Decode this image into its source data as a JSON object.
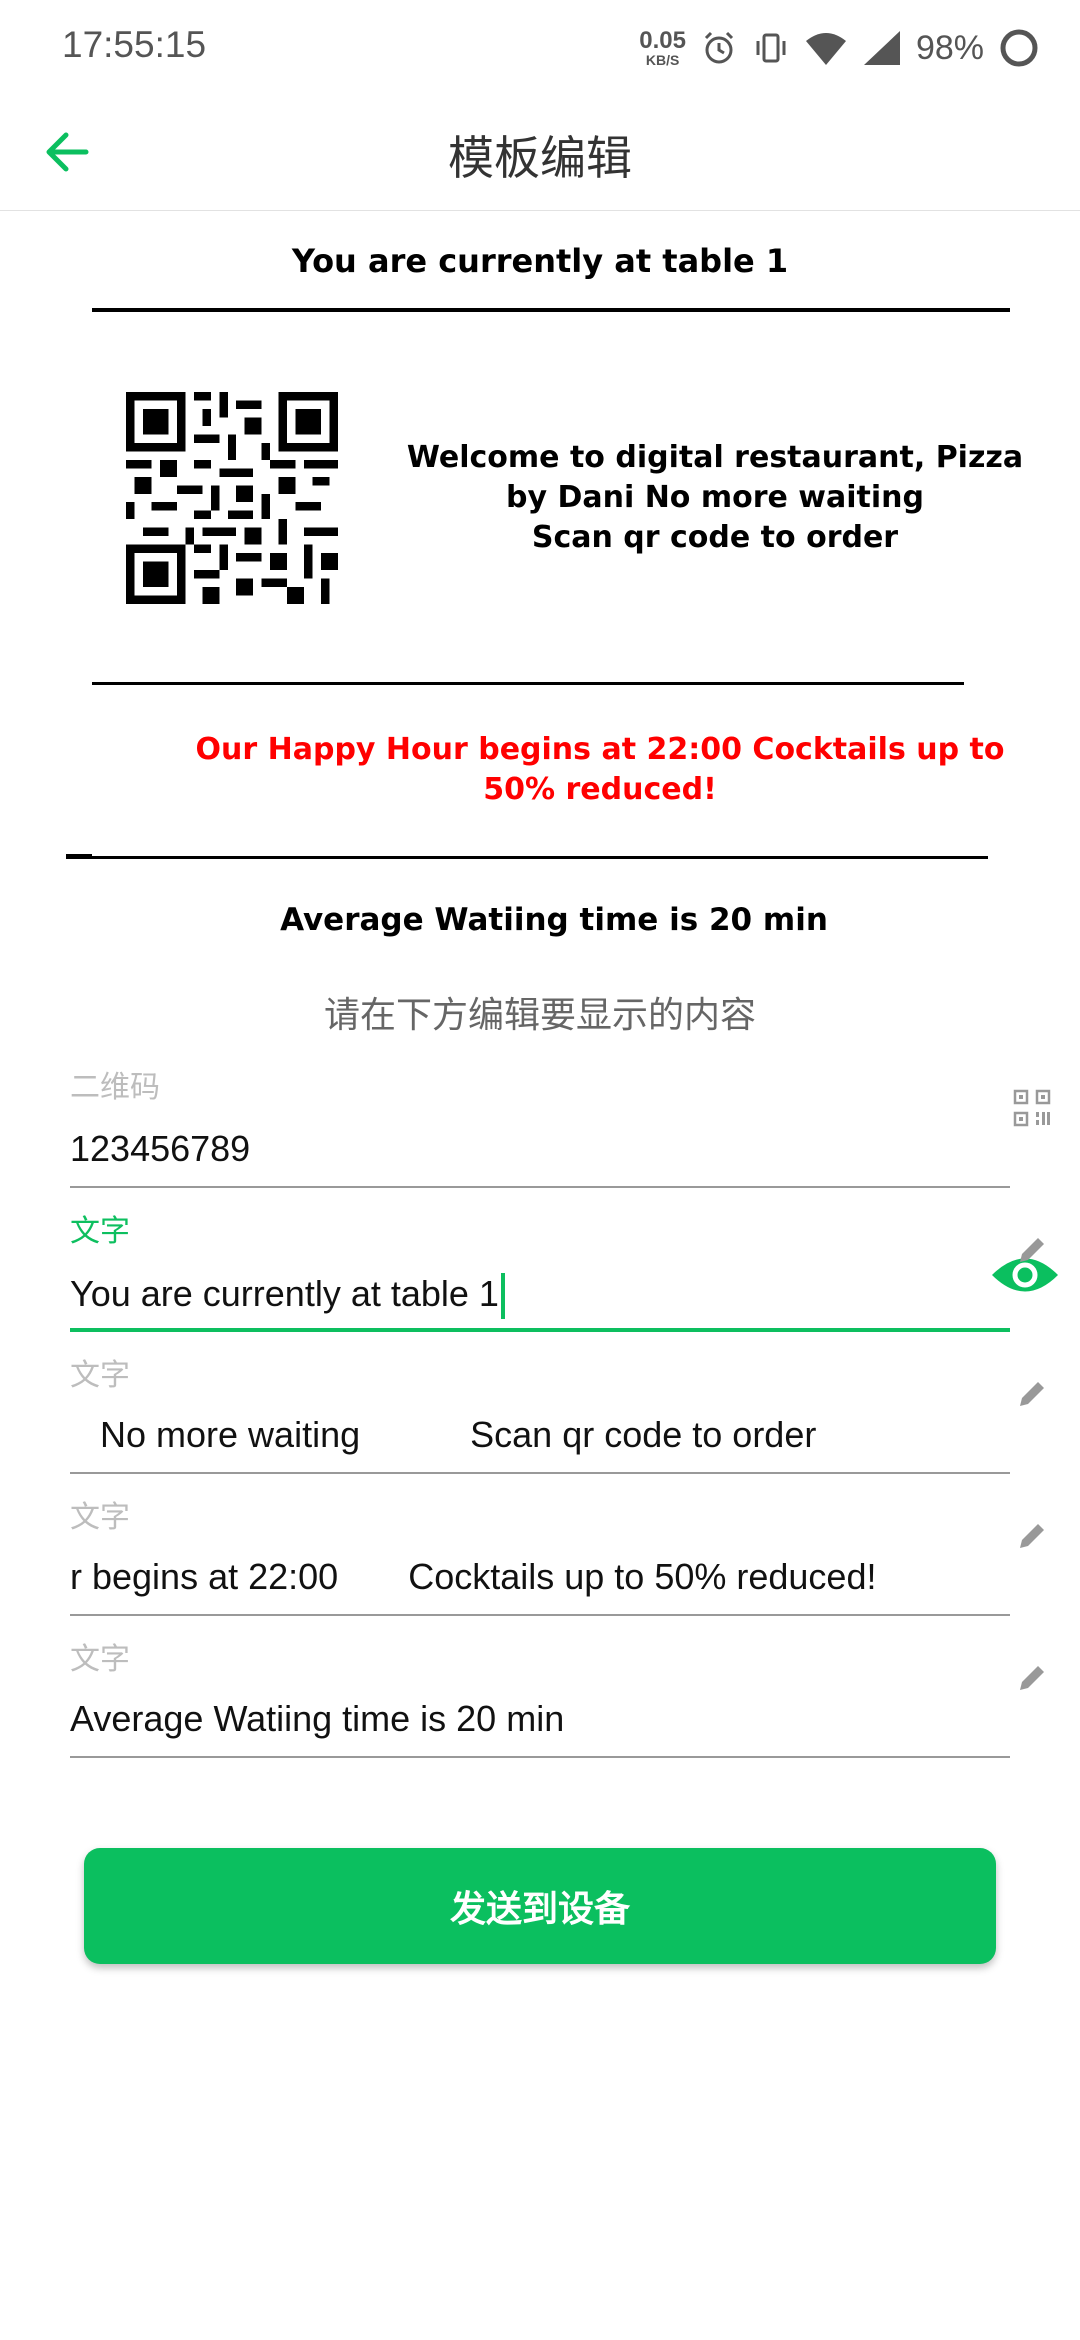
{
  "status": {
    "time": "17:55:15",
    "net_speed_value": "0.05",
    "net_speed_unit": "KB/S",
    "battery": "98%",
    "icons": [
      "alarm-icon",
      "vibrate-icon",
      "wifi-icon",
      "signal-icon",
      "battery-icon"
    ]
  },
  "app_bar": {
    "title": "模板编辑",
    "back_icon": "arrow-left-icon"
  },
  "preview": {
    "title": "You are currently at table 1",
    "welcome_line1": "Welcome to digital restaurant,   Pizza",
    "welcome_line2": "by Dani            No more waiting",
    "welcome_line3": "Scan qr code to order",
    "promo_line1": "Our Happy Hour begins at 22:00       Cocktails up to",
    "promo_line2": "50% reduced!",
    "footer": "Average Watiing time is 20 min",
    "promo_color": "#ff0000"
  },
  "hint": "请在下方编辑要显示的内容",
  "fields": [
    {
      "label": "二维码",
      "value": "123456789",
      "icon": "qr-code-icon"
    },
    {
      "label": "文字",
      "value": "You are currently at table 1",
      "icon": "pencil-icon",
      "active": true
    },
    {
      "label": "文字",
      "value": "   No more waiting           Scan qr code to order",
      "icon": "pencil-icon"
    },
    {
      "label": "文字",
      "value": "r begins at 22:00       Cocktails up to 50% reduced!",
      "icon": "pencil-icon"
    },
    {
      "label": "文字",
      "value": "Average Watiing time is 20 min",
      "icon": "pencil-icon"
    }
  ],
  "send_button": "发送到设备",
  "accent_color": "#0bbf5f"
}
